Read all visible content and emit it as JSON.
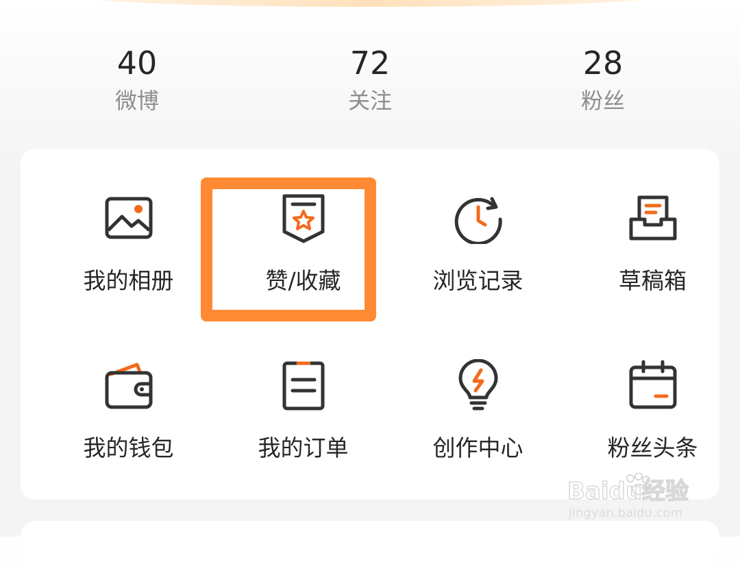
{
  "stats": [
    {
      "value": "40",
      "label": "微博"
    },
    {
      "value": "72",
      "label": "关注"
    },
    {
      "value": "28",
      "label": "粉丝"
    }
  ],
  "menu": [
    {
      "label": "我的相册",
      "icon": "photo-album-icon"
    },
    {
      "label": "赞/收藏",
      "icon": "favorite-star-icon"
    },
    {
      "label": "浏览记录",
      "icon": "history-clock-icon"
    },
    {
      "label": "草稿箱",
      "icon": "drafts-tray-icon"
    },
    {
      "label": "我的钱包",
      "icon": "wallet-icon"
    },
    {
      "label": "我的订单",
      "icon": "order-list-icon"
    },
    {
      "label": "创作中心",
      "icon": "creation-bulb-icon"
    },
    {
      "label": "粉丝头条",
      "icon": "calendar-icon"
    }
  ],
  "watermark": {
    "brand": "Baidu经验",
    "url": "jingyan.baidu.com"
  },
  "colors": {
    "accent": "#f26a1b",
    "icon_stroke": "#333333",
    "highlight": "#ff8a33",
    "text_primary": "#262626",
    "text_secondary": "#8d8d8d"
  }
}
